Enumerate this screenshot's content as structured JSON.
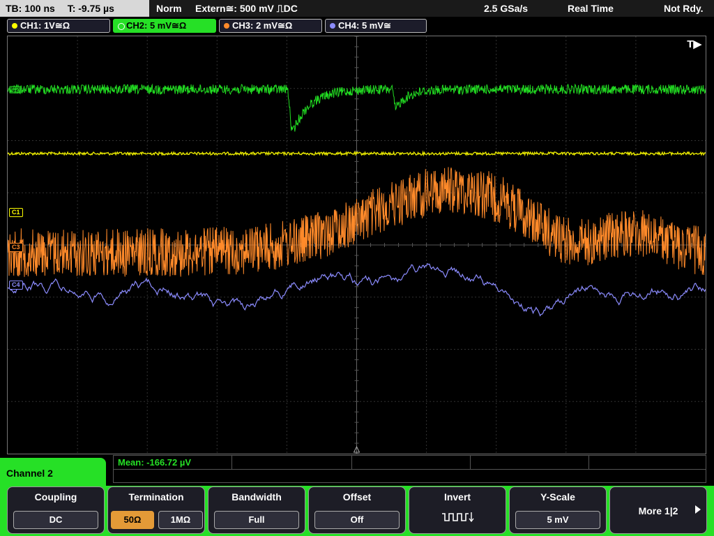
{
  "status": {
    "timebase": "TB: 100 ns",
    "trigger_time": "T: -9.75 µs",
    "mode": "Norm",
    "trigger": "Extern≅: 500 mV ⎍DC",
    "sample_rate": "2.5 GSa/s",
    "acq_mode": "Real Time",
    "state": "Not Rdy."
  },
  "channels": [
    {
      "label": "CH1: 1V≅Ω",
      "color": "#ffff00",
      "active": false
    },
    {
      "label": "CH2: 5 mV≅Ω",
      "color": "#26e026",
      "active": true
    },
    {
      "label": "CH3: 2 mV≅Ω",
      "color": "#ff8a2a",
      "active": false
    },
    {
      "label": "CH4: 5 mV≅",
      "color": "#8c8cff",
      "active": false
    }
  ],
  "grid": {
    "trigger_marker": "T▶",
    "markers": {
      "c2": "C2",
      "c1": "C1",
      "c3": "C3",
      "c4": "C4"
    }
  },
  "measurement": {
    "text": "Mean: -166.72 µV"
  },
  "menu": {
    "title": "Channel 2",
    "coupling": {
      "title": "Coupling",
      "value": "DC"
    },
    "termination": {
      "title": "Termination",
      "opt1": "50Ω",
      "opt2": "1MΩ",
      "selected": "50Ω"
    },
    "bandwidth": {
      "title": "Bandwidth",
      "value": "Full"
    },
    "offset": {
      "title": "Offset",
      "value": "Off"
    },
    "invert": {
      "title": "Invert"
    },
    "yscale": {
      "title": "Y-Scale",
      "value": "5 mV"
    },
    "more": {
      "label": "More 1|2"
    }
  }
}
